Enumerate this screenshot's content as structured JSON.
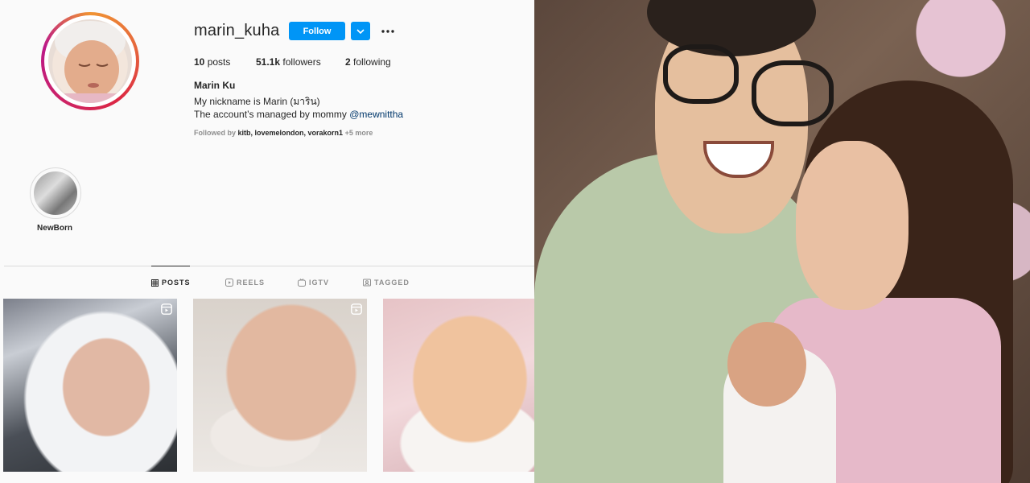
{
  "profile": {
    "username": "marin_kuha",
    "follow_label": "Follow",
    "stats": {
      "posts_value": "10",
      "posts_label": "posts",
      "followers_value": "51.1k",
      "followers_label": "followers",
      "following_value": "2",
      "following_label": "following"
    },
    "bio": {
      "name": "Marin Ku",
      "line1": "My nickname is Marin (มาริน)",
      "line2_prefix": "The account’s managed by mommy",
      "line2_mention": "@mewnittha"
    },
    "followed_by": {
      "prefix": "Followed by",
      "names": "kitb, lovemelondon, vorakorn1",
      "more": "+5 more"
    }
  },
  "highlights": [
    {
      "label": "NewBorn"
    }
  ],
  "tabs": [
    {
      "label": "POSTS",
      "icon": "grid-icon",
      "active": true
    },
    {
      "label": "REELS",
      "icon": "reels-icon",
      "active": false
    },
    {
      "label": "IGTV",
      "icon": "igtv-icon",
      "active": false
    },
    {
      "label": "TAGGED",
      "icon": "tagged-icon",
      "active": false
    }
  ],
  "posts": [
    {
      "has_reel_badge": true
    },
    {
      "has_reel_badge": true
    },
    {
      "has_reel_badge": false
    }
  ],
  "colors": {
    "accent": "#0095f6",
    "text": "#262626",
    "muted": "#8e8e8e",
    "link": "#00376b",
    "background": "#fafafa"
  }
}
